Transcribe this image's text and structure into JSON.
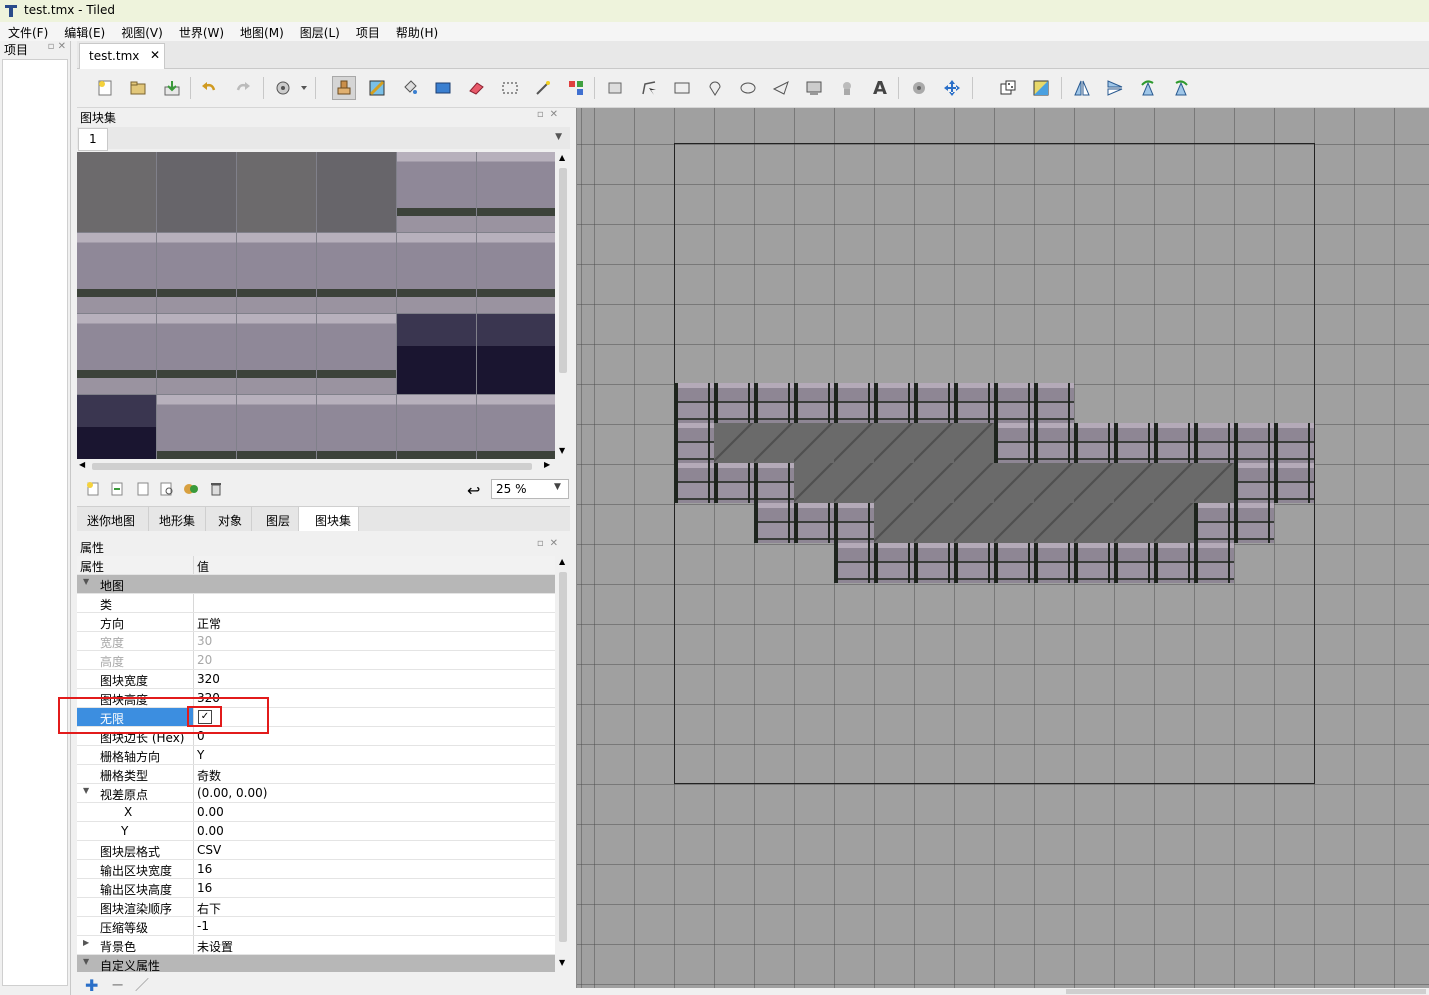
{
  "window": {
    "title": "test.tmx - Tiled"
  },
  "menu": [
    "文件(F)",
    "编辑(E)",
    "视图(V)",
    "世界(W)",
    "地图(M)",
    "图层(L)",
    "项目",
    "帮助(H)"
  ],
  "project_dock": {
    "title": "项目"
  },
  "document": {
    "tab_label": "test.tmx",
    "close_glyph": "✕"
  },
  "toolbar": {
    "icons": [
      "new-map-icon",
      "open-icon",
      "save-icon",
      "undo-icon",
      "redo-icon",
      "command-icon",
      "stamp-brush-icon",
      "terrain-brush-icon",
      "bucket-fill-icon",
      "shape-fill-icon",
      "eraser-icon",
      "rect-select-icon",
      "magic-wand-icon",
      "select-same-tile-icon",
      "select-objects-icon",
      "edit-polygons-icon",
      "insert-rectangle-icon",
      "insert-point-icon",
      "insert-ellipse-icon",
      "insert-polygon-icon",
      "insert-tile-icon",
      "insert-template-icon",
      "insert-text-icon",
      "world-tool-icon",
      "move-icon",
      "random-mode-icon",
      "wang-fill-icon",
      "flip-horizontal-icon",
      "flip-vertical-icon",
      "rotate-left-icon",
      "rotate-right-icon"
    ],
    "text_tool_glyph": "A"
  },
  "tileset_dock": {
    "title": "图块集",
    "tab_label": "1",
    "zoom": "25 %"
  },
  "dock_tabs": [
    "迷你地图",
    "地形集",
    "对象",
    "图层",
    "图块集"
  ],
  "properties": {
    "title": "属性",
    "col_name": "属性",
    "col_value": "值",
    "group_map": "地图",
    "rows": [
      {
        "k": "类",
        "v": ""
      },
      {
        "k": "方向",
        "v": "正常"
      },
      {
        "k": "宽度",
        "v": "30"
      },
      {
        "k": "高度",
        "v": "20"
      },
      {
        "k": "图块宽度",
        "v": "320"
      },
      {
        "k": "图块高度",
        "v": "320"
      },
      {
        "k": "无限",
        "v": "✓"
      },
      {
        "k": "图块边长 (Hex)",
        "v": "0"
      },
      {
        "k": "栅格轴方向",
        "v": "Y"
      },
      {
        "k": "栅格类型",
        "v": "奇数"
      },
      {
        "k": "视差原点",
        "v": "(0.00, 0.00)"
      },
      {
        "k": "X",
        "v": "0.00"
      },
      {
        "k": "Y",
        "v": "0.00"
      },
      {
        "k": "图块层格式",
        "v": "CSV"
      },
      {
        "k": "输出区块宽度",
        "v": "16"
      },
      {
        "k": "输出区块高度",
        "v": "16"
      },
      {
        "k": "图块渲染顺序",
        "v": "右下"
      },
      {
        "k": "压缩等级",
        "v": "-1"
      },
      {
        "k": "背景色",
        "v": "未设置"
      }
    ],
    "group_custom": "自定义属性",
    "infinite_checked": true
  },
  "colors": {
    "highlight": "#e21b1b",
    "selection": "#3c8ee0",
    "canvas": "#a0a0a0"
  }
}
